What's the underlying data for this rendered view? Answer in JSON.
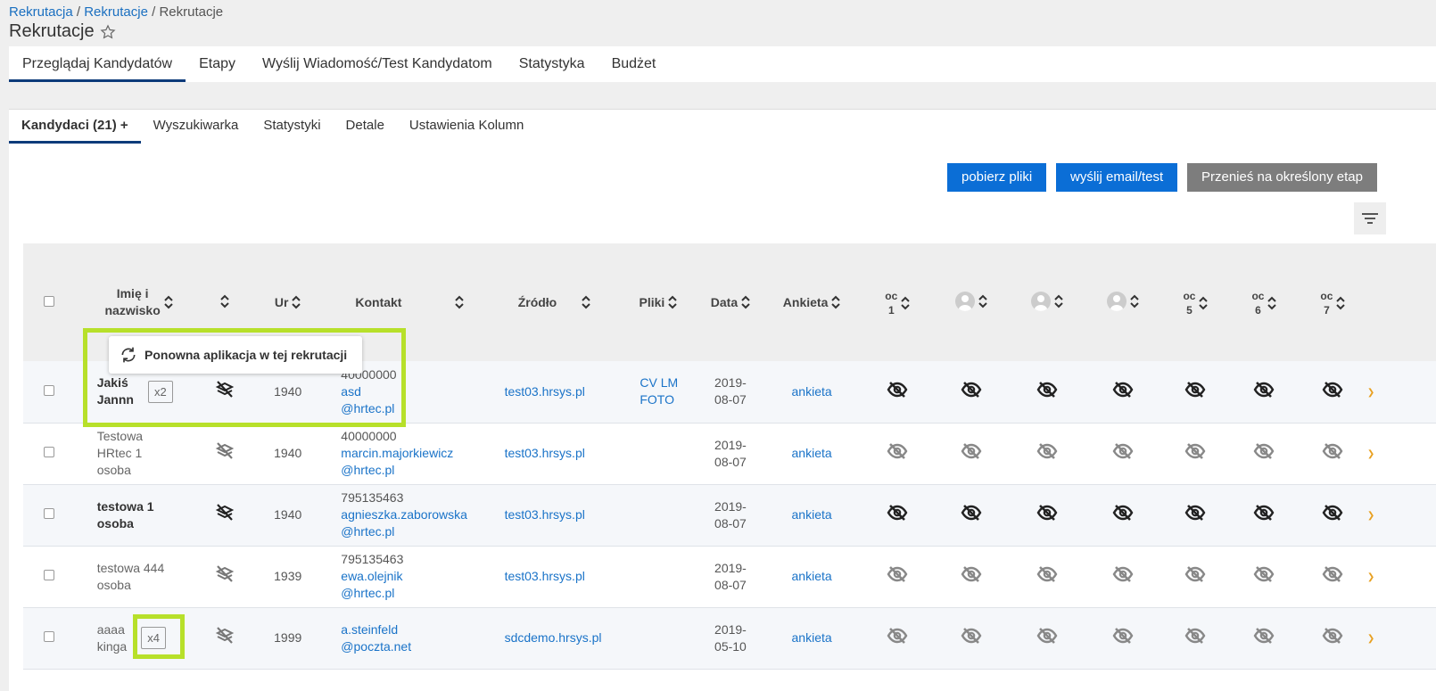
{
  "breadcrumb": {
    "items": [
      "Rekrutacja",
      "Rekrutacje",
      "Rekrutacje"
    ],
    "sep": "/"
  },
  "page": {
    "title": "Rekrutacje"
  },
  "main_tabs": [
    "Przeglądaj Kandydatów",
    "Etapy",
    "Wyślij Wiadomość/Test Kandydatom",
    "Statystyka",
    "Budżet"
  ],
  "sub_tabs": [
    "Kandydaci (21) +",
    "Wyszukiwarka",
    "Statystyki",
    "Detale",
    "Ustawienia Kolumn"
  ],
  "actions": {
    "download": "pobierz pliki",
    "send": "wyślij email/test",
    "move": "Przenieś na określony etap"
  },
  "table": {
    "headers": {
      "name_line1": "Imię i",
      "name_line2": "nazwisko",
      "born": "Ur",
      "contact": "Kontakt",
      "source": "Źródło",
      "files": "Pliki",
      "date": "Data",
      "survey": "Ankieta",
      "oc1_a": "oc",
      "oc1_b": "1",
      "oc5_a": "oc",
      "oc5_b": "5",
      "oc6_a": "oc",
      "oc6_b": "6",
      "oc7_a": "oc",
      "oc7_b": "7"
    },
    "rows": [
      {
        "name1": "Jakiś",
        "name2": "Jannn",
        "name3": "",
        "bold": true,
        "badge": "x2",
        "born": "1940",
        "phone": "40000000",
        "email1": "asd",
        "email2": "@hrtec.pl",
        "source": "test03.hrsys.pl",
        "file1": "CV LM",
        "file2": "FOTO",
        "date1": "2019-",
        "date2": "08-07",
        "survey": "ankieta"
      },
      {
        "name1": "Testowa",
        "name2": "HRtec 1",
        "name3": "osoba",
        "bold": false,
        "badge": "",
        "born": "1940",
        "phone": "40000000",
        "email1": "marcin.majorkiewicz",
        "email2": "@hrtec.pl",
        "source": "test03.hrsys.pl",
        "file1": "",
        "file2": "",
        "date1": "2019-",
        "date2": "08-07",
        "survey": "ankieta"
      },
      {
        "name1": "testowa 1",
        "name2": "osoba",
        "name3": "",
        "bold": true,
        "badge": "",
        "born": "1940",
        "phone": "795135463",
        "email1": "agnieszka.zaborowska",
        "email2": "@hrtec.pl",
        "source": "test03.hrsys.pl",
        "file1": "",
        "file2": "",
        "date1": "2019-",
        "date2": "08-07",
        "survey": "ankieta"
      },
      {
        "name1": "testowa 444",
        "name2": "osoba",
        "name3": "",
        "bold": false,
        "badge": "",
        "born": "1939",
        "phone": "795135463",
        "email1": "ewa.olejnik",
        "email2": "@hrtec.pl",
        "source": "test03.hrsys.pl",
        "file1": "",
        "file2": "",
        "date1": "2019-",
        "date2": "08-07",
        "survey": "ankieta"
      },
      {
        "name1": "aaaa",
        "name2": "kinga",
        "name3": "",
        "bold": false,
        "badge": "x4",
        "born": "1999",
        "phone": "",
        "email1": "a.steinfeld",
        "email2": "@poczta.net",
        "source": "sdcdemo.hrsys.pl",
        "file1": "",
        "file2": "",
        "date1": "2019-",
        "date2": "05-10",
        "survey": "ankieta"
      }
    ]
  },
  "tooltip": {
    "text": "Ponowna aplikacja w tej rekrutacji"
  },
  "icons": {
    "eye": "eye-slash-icon",
    "visibility": "layers-slash-icon",
    "sort": "sort-icon",
    "star": "star-icon",
    "filter": "filter-icon",
    "refresh": "refresh-icon"
  },
  "colors": {
    "link": "#1a73c8",
    "primary": "#0b6ed6",
    "secondary": "#7d7d7d",
    "highlight": "#b7e02a",
    "active_tab": "#0d3b7a"
  }
}
